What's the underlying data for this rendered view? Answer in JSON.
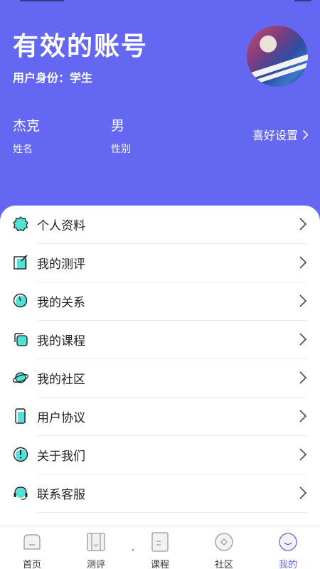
{
  "header": {
    "account_title": "有效的账号",
    "identity": "用户身份：学生",
    "name_value": "杰克",
    "name_label": "姓名",
    "gender_value": "男",
    "gender_label": "性别",
    "preferences_link": "喜好设置",
    "background_color": "#6467f2"
  },
  "menu": {
    "items": [
      {
        "label": "个人资料",
        "icon": "badge-icon"
      },
      {
        "label": "我的测评",
        "icon": "edit-box-icon"
      },
      {
        "label": "我的关系",
        "icon": "circle-icon"
      },
      {
        "label": "我的课程",
        "icon": "stack-icon"
      },
      {
        "label": "我的社区",
        "icon": "planet-icon"
      },
      {
        "label": "用户协议",
        "icon": "phone-doc-icon"
      },
      {
        "label": "关于我们",
        "icon": "info-icon"
      },
      {
        "label": "联系客服",
        "icon": "headset-icon"
      }
    ]
  },
  "tabbar": {
    "tabs": [
      {
        "label": "首页",
        "icon": "home-icon"
      },
      {
        "label": "测评",
        "icon": "book-icon"
      },
      {
        "label": "课程",
        "icon": "course-icon"
      },
      {
        "label": "社区",
        "icon": "community-icon"
      },
      {
        "label": "我的",
        "icon": "profile-icon"
      }
    ],
    "active_tab": "我的",
    "active_color": "#6467f2"
  }
}
